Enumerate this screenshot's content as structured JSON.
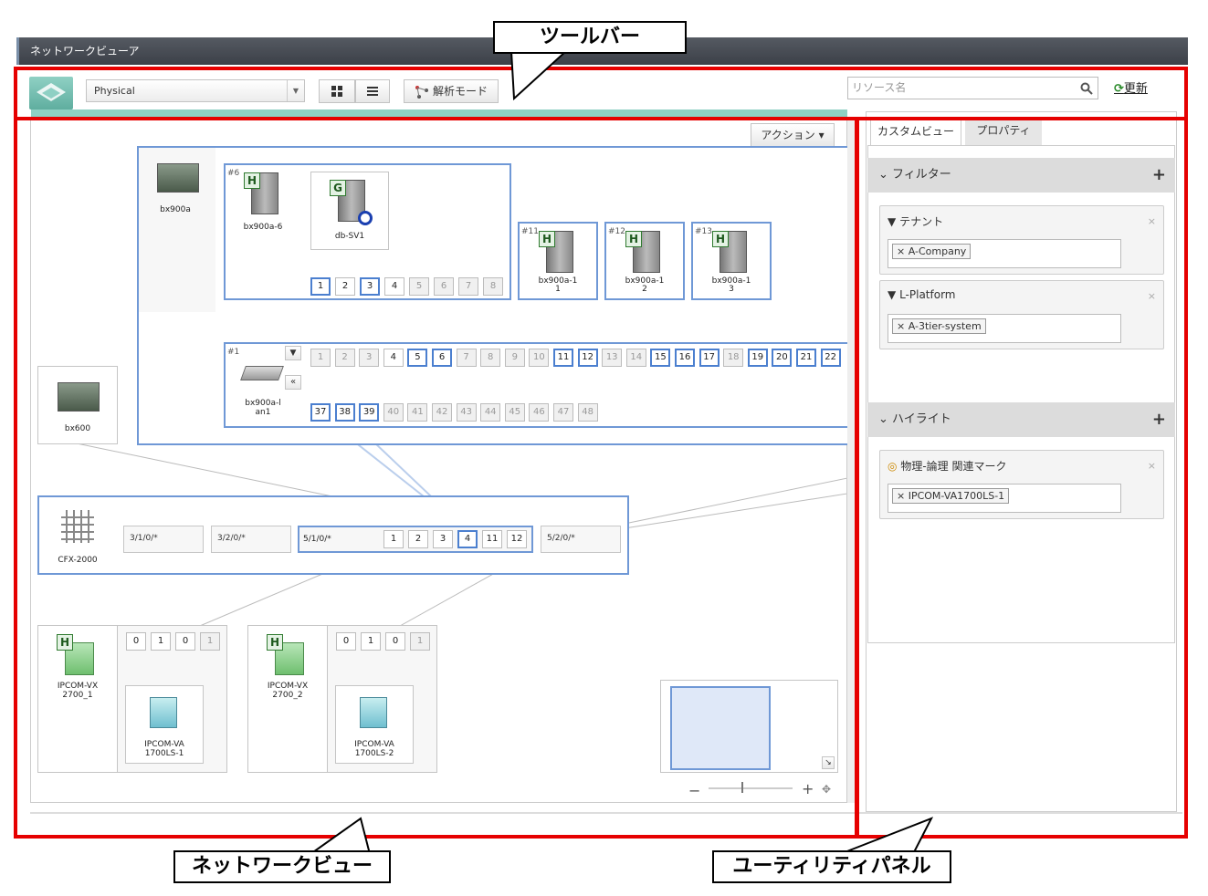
{
  "window_title": "ネットワークビューア",
  "toolbar": {
    "view_select": "Physical",
    "grid_icon": "grid-view-icon",
    "list_icon": "list-view-icon",
    "analysis_mode": "解析モード",
    "search_placeholder": "リソース名",
    "refresh": "更新"
  },
  "netview": {
    "action_button": "アクション",
    "chassis_bx900a": "bx900a",
    "chassis_bx600": "bx600",
    "slot6": "#6",
    "server_bx900a6": "bx900a-6",
    "vm_db_sv1": "db-SV1",
    "slot11": "#11",
    "slot12": "#12",
    "slot13": "#13",
    "server_bx900a11": "bx900a-1\n1",
    "server_bx900a12": "bx900a-1\n2",
    "server_bx900a13": "bx900a-1\n3",
    "slot1": "#1",
    "lan_switch": "bx900a-l\nan1",
    "blade_ports": [
      "1",
      "2",
      "3",
      "4",
      "5",
      "6",
      "7",
      "8"
    ],
    "lan_ports_row1": [
      "1",
      "2",
      "3",
      "4",
      "5",
      "6",
      "7",
      "8",
      "9",
      "10",
      "11",
      "12",
      "13",
      "14",
      "15",
      "16",
      "17",
      "18",
      "19",
      "20",
      "21",
      "22"
    ],
    "lan_ports_row2": [
      "37",
      "38",
      "39",
      "40",
      "41",
      "42",
      "43",
      "44",
      "45",
      "46",
      "47",
      "48"
    ],
    "cfx": "CFX-2000",
    "cfx_groups": [
      "3/1/0/*",
      "3/2/0/*",
      "5/1/0/*",
      "5/2/0/*"
    ],
    "cfx_ports": [
      "1",
      "2",
      "3",
      "4",
      "11",
      "12"
    ],
    "ipcom_vx1": "IPCOM-VX\n2700_1",
    "ipcom_vx2": "IPCOM-VX\n2700_2",
    "ipcom_va1": "IPCOM-VA\n1700LS-1",
    "ipcom_va2": "IPCOM-VA\n1700LS-2",
    "ipcom_ports": [
      "0",
      "1",
      "0",
      "1"
    ],
    "zoom_minus": "−",
    "zoom_plus": "+"
  },
  "utility": {
    "tab_custom": "カスタムビュー",
    "tab_property": "プロパティ",
    "filter_header": "フィルター",
    "tenant_label": "テナント",
    "tenant_value": "A-Company",
    "lplatform_label": "L-Platform",
    "lplatform_value": "A-3tier-system",
    "highlight_header": "ハイライト",
    "mark_label": "物理-論理 関連マーク",
    "mark_value": "IPCOM-VA1700LS-1"
  },
  "callouts": {
    "toolbar": "ツールバー",
    "network_view": "ネットワークビュー",
    "utility_panel": "ユーティリティパネル"
  },
  "colors": {
    "highlight_red": "#e60000",
    "node_blue": "#6f98d6",
    "teal": "#8fd0c4"
  }
}
